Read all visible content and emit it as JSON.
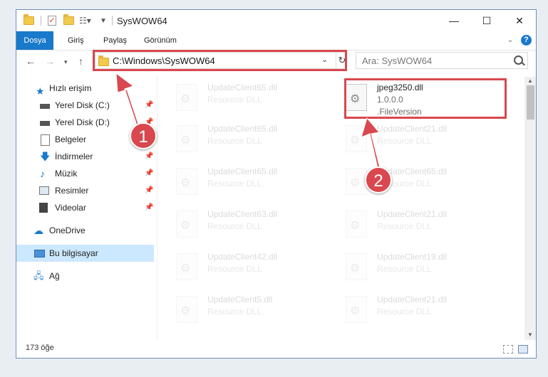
{
  "window": {
    "title": "SysWOW64",
    "min": "—",
    "max": "☐",
    "close": "✕"
  },
  "ribbon": {
    "tabs": [
      "Dosya",
      "Giriş",
      "Paylaş",
      "Görünüm"
    ],
    "help": "?"
  },
  "address": {
    "path": "C:\\Windows\\SysWOW64",
    "refresh": "↻"
  },
  "search": {
    "placeholder": "Ara: SysWOW64"
  },
  "nav": {
    "quick_access": "Hızlı erişim",
    "items": [
      {
        "label": "Yerel Disk (C:)",
        "pinned": true
      },
      {
        "label": "Yerel Disk (D:)",
        "pinned": true
      },
      {
        "label": "Belgeler",
        "pinned": true
      },
      {
        "label": "İndirmeler",
        "pinned": true
      },
      {
        "label": "Müzik",
        "pinned": true
      },
      {
        "label": "Resimler",
        "pinned": true
      },
      {
        "label": "Videolar",
        "pinned": true
      }
    ],
    "onedrive": "OneDrive",
    "this_pc": "Bu bilgisayar",
    "network": "Ağ"
  },
  "files": [
    {
      "name": "UpdateClient65.dll",
      "desc": "Resource DLL"
    },
    {
      "name": "jpeg3250.dll",
      "version": "1.0.0.0",
      "desc": ".FileVersion"
    },
    {
      "name": "UpdateClient65.dll",
      "desc": "Resource DLL"
    },
    {
      "name": "UpdateClient21.dll",
      "desc": "Resource DLL"
    },
    {
      "name": "UpdateClient65.dll",
      "desc": "Resource DLL"
    },
    {
      "name": "UpdateClient65.dll",
      "desc": "Resource DLL"
    },
    {
      "name": "UpdateClient63.dll",
      "desc": "Resource DLL"
    },
    {
      "name": "UpdateClient21.dll",
      "desc": "Resource DLL"
    },
    {
      "name": "UpdateClient42.dll",
      "desc": "Resource DLL"
    },
    {
      "name": "UpdateClient19.dll",
      "desc": "Resource DLL"
    },
    {
      "name": "UpdateClient5.dll",
      "desc": "Resource DLL"
    },
    {
      "name": "UpdateClient21.dll",
      "desc": "Resource DLL"
    }
  ],
  "status": {
    "count": "173 öğe"
  },
  "annotations": [
    "1",
    "2"
  ],
  "colors": {
    "accent": "#1979ca",
    "highlight": "#d9474f",
    "selected": "#cce8ff"
  }
}
